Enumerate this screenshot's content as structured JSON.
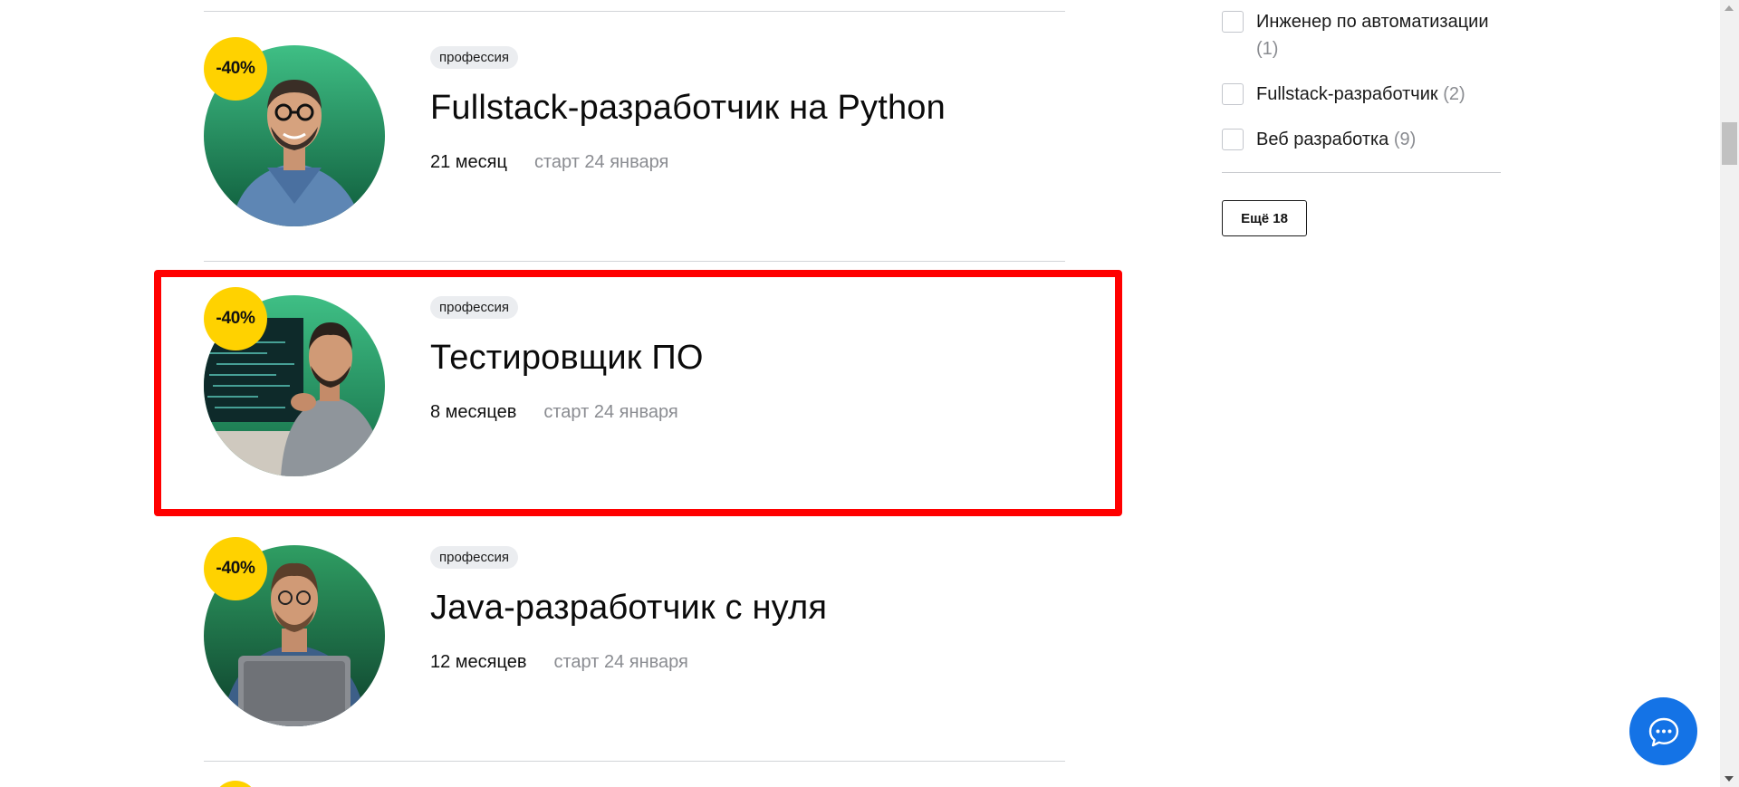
{
  "courses": [
    {
      "discount": "-40%",
      "tag": "профессия",
      "title": "Fullstack-разработчик на Python",
      "duration": "21 месяц",
      "start": "старт 24 января"
    },
    {
      "discount": "-40%",
      "tag": "профессия",
      "title": "Тестировщик ПО",
      "duration": "8 месяцев",
      "start": "старт 24 января"
    },
    {
      "discount": "-40%",
      "tag": "профессия",
      "title": "Java-разработчик с нуля",
      "duration": "12 месяцев",
      "start": "старт 24 января"
    }
  ],
  "filters": [
    {
      "label": "Инженер по автоматизации",
      "count": "(1)",
      "checked": false
    },
    {
      "label": "Fullstack-разработчик",
      "count": "(2)",
      "checked": false
    },
    {
      "label": "Веб разработка",
      "count": "(9)",
      "checked": false
    }
  ],
  "more_button": "Ещё 18",
  "colors": {
    "discount_badge": "#ffd200",
    "highlight": "#ff0000",
    "chat_button": "#1473e6",
    "avatar_green": "#2f9e63"
  },
  "icons": {
    "chat": "chat-bubble-icon",
    "avatars": [
      "instructor-photo",
      "tester-photo",
      "java-developer-photo"
    ]
  }
}
